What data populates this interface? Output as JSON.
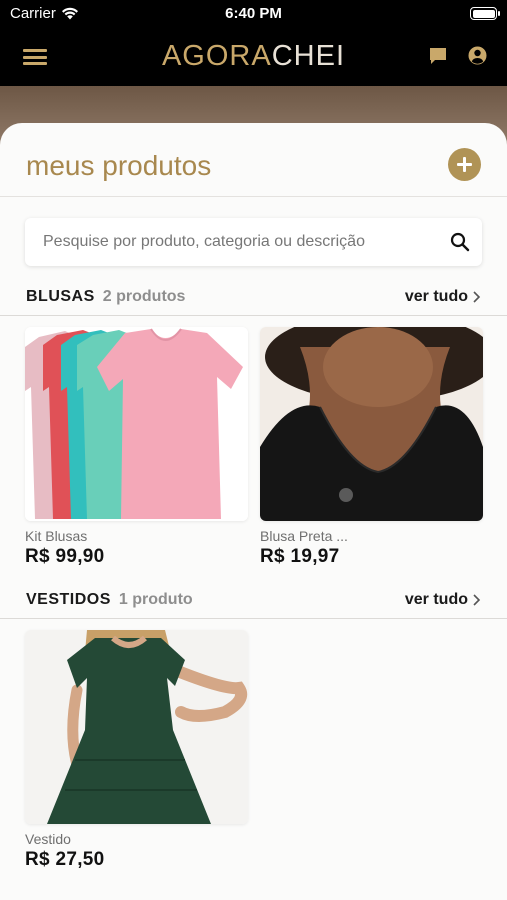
{
  "status_bar": {
    "carrier": "Carrier",
    "time": "6:40 PM"
  },
  "header": {
    "logo_part1": "AGORA",
    "logo_part2": "CHEI"
  },
  "page": {
    "title": "meus produtos"
  },
  "search": {
    "placeholder": "Pesquise por produto, categoria ou descrição"
  },
  "sections": [
    {
      "name": "BLUSAS",
      "count": "2 produtos",
      "see_all": "ver tudo",
      "products": [
        {
          "title": "Kit Blusas",
          "price": "R$ 99,90"
        },
        {
          "title": "Blusa Preta ...",
          "price": "R$ 19,97"
        }
      ]
    },
    {
      "name": "VESTIDOS",
      "count": "1 produto",
      "see_all": "ver tudo",
      "products": [
        {
          "title": "Vestido",
          "price": "R$ 27,50"
        }
      ]
    }
  ],
  "colors": {
    "accent": "#b09356",
    "title": "#a8884e",
    "nav_bg": "#000000"
  }
}
